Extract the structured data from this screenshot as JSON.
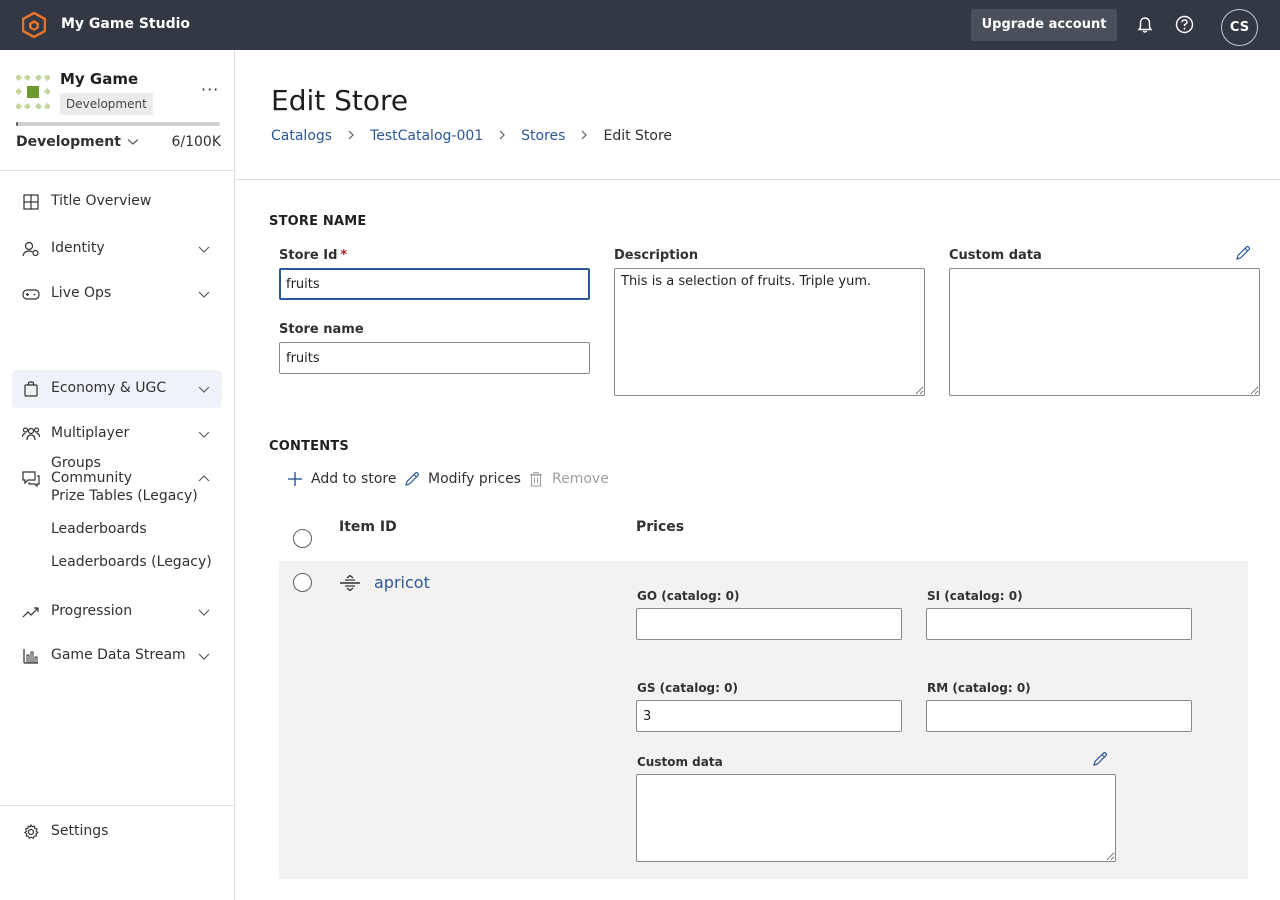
{
  "app": {
    "brand_name": "My Game Studio",
    "upgrade_label": "Upgrade account",
    "user_initials": "CS",
    "brand_color": "#e8742a"
  },
  "sidebar": {
    "game_name": "My Game",
    "env_badge": "Development",
    "more": "···",
    "env_select": "Development",
    "usage_count": "6/100K",
    "usage_fraction": 6e-05,
    "items": [
      {
        "label": "Title Overview",
        "icon": "grid-icon",
        "expandable": false
      },
      {
        "label": "Identity",
        "icon": "identity-icon",
        "expandable": true
      },
      {
        "label": "Live Ops",
        "icon": "gamepad-icon",
        "expandable": true
      },
      {
        "label": "Economy & UGC",
        "icon": "shopping-bag-icon",
        "expandable": true,
        "active": true
      },
      {
        "label": "Multiplayer",
        "icon": "people-icon",
        "expandable": true
      },
      {
        "label": "Community",
        "icon": "chat-icon",
        "expandable": true,
        "expanded": true
      },
      {
        "label": "Progression",
        "icon": "trend-icon",
        "expandable": true
      },
      {
        "label": "Game Data Stream",
        "icon": "bar-chart-icon",
        "expandable": true
      }
    ],
    "community_sub": [
      "Groups",
      "Prize Tables (Legacy)",
      "Leaderboards",
      "Leaderboards (Legacy)"
    ],
    "settings_label": "Settings"
  },
  "page": {
    "title": "Edit Store",
    "breadcrumb": [
      "Catalogs",
      "TestCatalog-001",
      "Stores"
    ],
    "breadcrumb_current": "Edit Store"
  },
  "store_name_section": {
    "title": "STORE NAME",
    "store_id_label": "Store Id",
    "required_mark": "*",
    "store_id_value": "fruits",
    "store_name_label": "Store name",
    "store_name_value": "fruits",
    "description_label": "Description",
    "description_value": "This is a selection of fruits. Triple yum.",
    "custom_data_label": "Custom data",
    "custom_data_value": ""
  },
  "contents_section": {
    "title": "CONTENTS",
    "add_label": "Add to store",
    "modify_label": "Modify prices",
    "remove_label": "Remove",
    "col_item_id": "Item ID",
    "col_prices": "Prices",
    "rows": [
      {
        "item_id": "apricot",
        "go_label": "GO (catalog: 0)",
        "go_value": "",
        "si_label": "SI (catalog: 0)",
        "si_value": "",
        "gs_label": "GS (catalog: 0)",
        "gs_value": "3",
        "rm_label": "RM (catalog: 0)",
        "rm_value": "",
        "custom_data_label": "Custom data",
        "custom_data_value": ""
      }
    ]
  }
}
